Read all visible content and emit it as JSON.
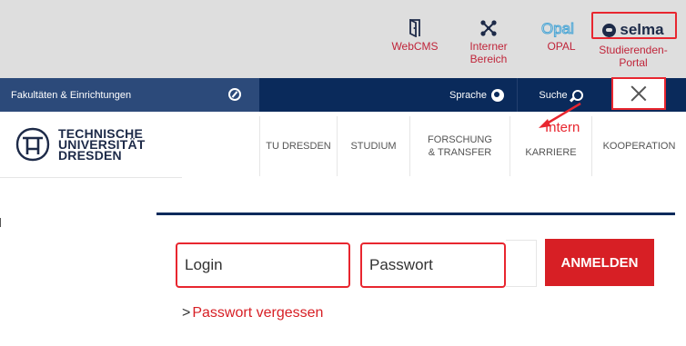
{
  "top_links": {
    "webcms": {
      "label": "WebCMS",
      "icon": "door-exit-icon"
    },
    "intern": {
      "label": "Interner Bereich",
      "icon": "network-icon"
    },
    "opal": {
      "label": "OPAL",
      "icon": "opal-logo",
      "logo_text": "Opal"
    },
    "selma": {
      "label": "Studierenden-Portal",
      "logo_text": "selma"
    }
  },
  "nav": {
    "faculties": "Fakultäten & Einrichtungen",
    "language": "Sprache",
    "search": "Suche"
  },
  "logo": {
    "line1": "TECHNISCHE",
    "line2": "UNIVERSITÄT",
    "line3": "DRESDEN"
  },
  "menu": {
    "tu": "TU DRESDEN",
    "studium": "STUDIUM",
    "forschung": "FORSCHUNG & TRANSFER",
    "karriere": "KARRIERE",
    "kooperation": "KOOPERATION"
  },
  "annotation": {
    "intern": "Intern"
  },
  "login": {
    "login_placeholder": "Login",
    "password_placeholder": "Passwort",
    "submit": "ANMELDEN",
    "forgot_chevron": ">",
    "forgot": "Passwort vergessen"
  },
  "colors": {
    "tu_red": "#d71f25",
    "navy": "#0a2a5b",
    "annotation_red": "#e8262f",
    "topbar_gray": "#dedede"
  }
}
